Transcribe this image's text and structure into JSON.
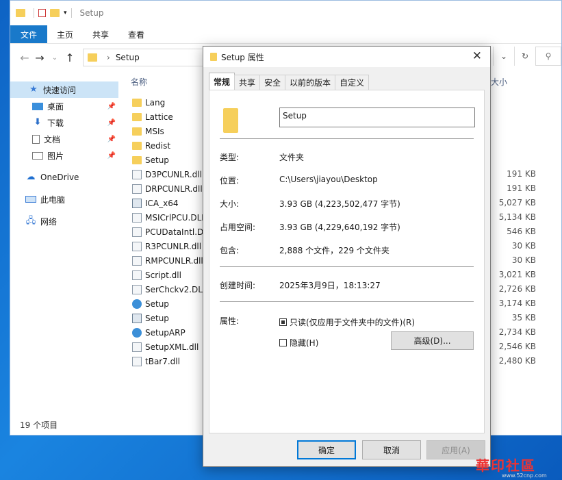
{
  "explorer": {
    "title": "Setup",
    "ribbon_tabs": [
      "文件",
      "主页",
      "共享",
      "查看"
    ],
    "address_path": "Setup",
    "column_name": "名称",
    "column_size": "大小",
    "sidebar": [
      {
        "label": "快速访问",
        "icon": "star-icon"
      },
      {
        "label": "桌面",
        "icon": "desktop-icon"
      },
      {
        "label": "下载",
        "icon": "download-icon"
      },
      {
        "label": "文档",
        "icon": "document-icon"
      },
      {
        "label": "图片",
        "icon": "picture-icon"
      },
      {
        "label": "OneDrive",
        "icon": "cloud-icon"
      },
      {
        "label": "此电脑",
        "icon": "computer-icon"
      },
      {
        "label": "网络",
        "icon": "network-icon"
      }
    ],
    "files": [
      {
        "name": "Lang",
        "type": "folder",
        "size": ""
      },
      {
        "name": "Lattice",
        "type": "folder",
        "size": ""
      },
      {
        "name": "MSIs",
        "type": "folder",
        "size": ""
      },
      {
        "name": "Redist",
        "type": "folder",
        "size": ""
      },
      {
        "name": "Setup",
        "type": "folder",
        "size": ""
      },
      {
        "name": "D3PCUNLR.dll",
        "type": "dll",
        "size": "191 KB"
      },
      {
        "name": "DRPCUNLR.dll",
        "type": "dll",
        "size": "191 KB"
      },
      {
        "name": "ICA_x64",
        "type": "exe",
        "size": "5,027 KB"
      },
      {
        "name": "MSICrlPCU.DLL",
        "type": "dll",
        "size": "5,134 KB"
      },
      {
        "name": "PCUDataIntl.DLL",
        "type": "dll",
        "size": "546 KB"
      },
      {
        "name": "R3PCUNLR.dll",
        "type": "dll",
        "size": "30 KB"
      },
      {
        "name": "RMPCUNLR.dll",
        "type": "dll",
        "size": "30 KB"
      },
      {
        "name": "Script.dll",
        "type": "dll",
        "size": "3,021 KB"
      },
      {
        "name": "SerChckv2.DLL",
        "type": "dll",
        "size": "2,726 KB"
      },
      {
        "name": "Setup",
        "type": "blue",
        "size": "3,174 KB"
      },
      {
        "name": "Setup",
        "type": "exe",
        "size": "35 KB"
      },
      {
        "name": "SetupARP",
        "type": "blue",
        "size": "2,734 KB"
      },
      {
        "name": "SetupXML.dll",
        "type": "dll",
        "size": "2,546 KB"
      },
      {
        "name": "tBar7.dll",
        "type": "dll",
        "size": "2,480 KB"
      }
    ],
    "status": "19 个项目"
  },
  "dialog": {
    "title": "Setup 属性",
    "tabs": [
      "常规",
      "共享",
      "安全",
      "以前的版本",
      "自定义"
    ],
    "name_value": "Setup",
    "type_label": "类型:",
    "type_value": "文件夹",
    "location_label": "位置:",
    "location_value": "C:\\Users\\jiayou\\Desktop",
    "size_label": "大小:",
    "size_value": "3.93 GB (4,223,502,477 字节)",
    "disk_label": "占用空间:",
    "disk_value": "3.93 GB (4,229,640,192 字节)",
    "contains_label": "包含:",
    "contains_value": "2,888 个文件，229 个文件夹",
    "created_label": "创建时间:",
    "created_value": "2025年3月9日，18:13:27",
    "attr_label": "属性:",
    "readonly_label": "只读(仅应用于文件夹中的文件)(R)",
    "hidden_label": "隐藏(H)",
    "advanced_button": "高级(D)...",
    "ok_button": "确定",
    "cancel_button": "取消",
    "apply_button": "应用(A)"
  },
  "watermark": {
    "text": "華印社區",
    "url": "www.52cnp.com"
  },
  "colors": {
    "accent": "#1979ca",
    "folder": "#f6cf5b",
    "selection": "#cce4f7"
  }
}
